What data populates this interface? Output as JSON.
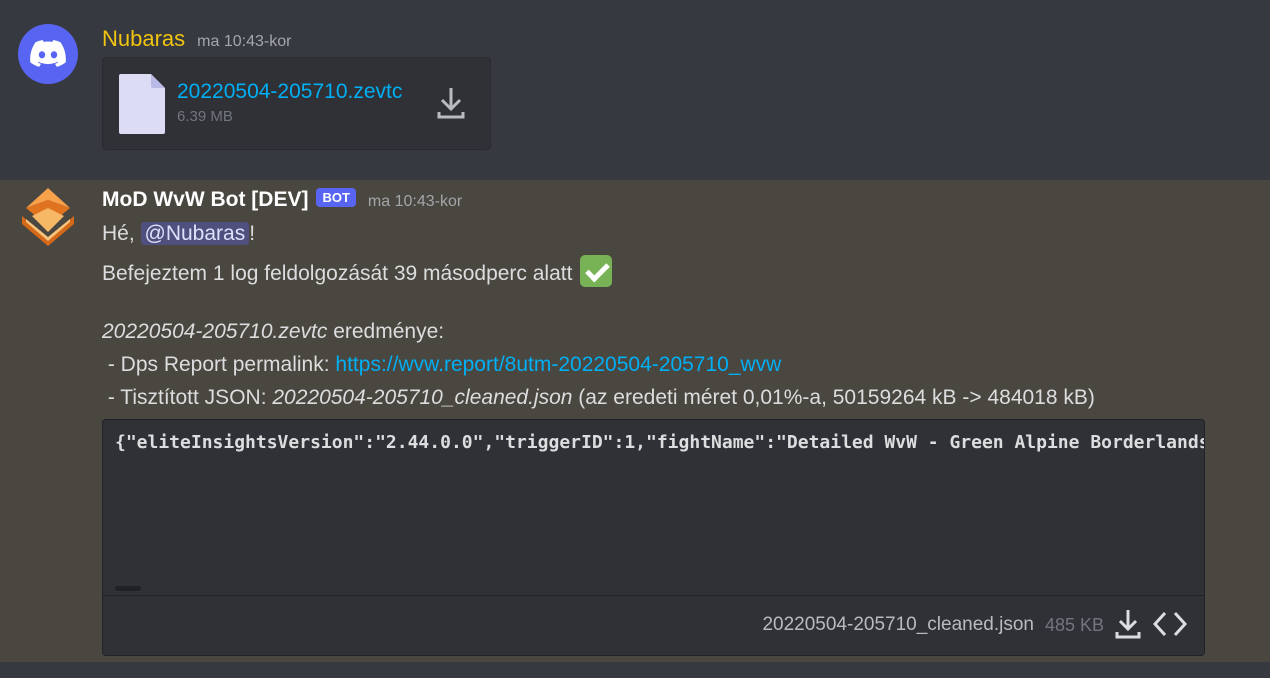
{
  "messages": [
    {
      "username": "Nubaras",
      "timestamp": "ma 10:43-kor",
      "avatar_icon": "discord-logo-icon",
      "attachment": {
        "filename": "20220504-205710.zevtc",
        "size": "6.39 MB"
      }
    },
    {
      "username": "MoD WvW Bot [DEV]",
      "bot_tag": "BOT",
      "timestamp": "ma 10:43-kor",
      "avatar_icon": "guild-emblem-icon",
      "greeting_prefix": "Hé, ",
      "mention": "@Nubaras",
      "greeting_suffix": "!",
      "line2": "Befejeztem 1 log feldolgozását 39 másodperc alatt",
      "result_filename": "20220504-205710.zevtc",
      "result_suffix": " eredménye:",
      "dps_prefix": " - Dps Report permalink: ",
      "dps_link": "https://wvw.report/8utm-20220504-205710_wvw",
      "json_prefix": " - Tisztított JSON: ",
      "json_filename": "20220504-205710_cleaned.json",
      "json_suffix": " (az eredeti méret 0,01%-a, 50159264 kB -> 484018 kB)",
      "code_preview": "{\"eliteInsightsVersion\":\"2.44.0.0\",\"triggerID\":1,\"fightName\":\"Detailed WvW - Green Alpine Borderlands\"",
      "code_file": {
        "filename": "20220504-205710_cleaned.json",
        "size": "485 KB"
      }
    }
  ],
  "colors": {
    "background": "#36393f",
    "highlight_background": "#4a4640",
    "nubaras_name": "#f1c40f",
    "link": "#00aff4",
    "bot_tag": "#5865f2",
    "check_emoji": "#77b255"
  }
}
